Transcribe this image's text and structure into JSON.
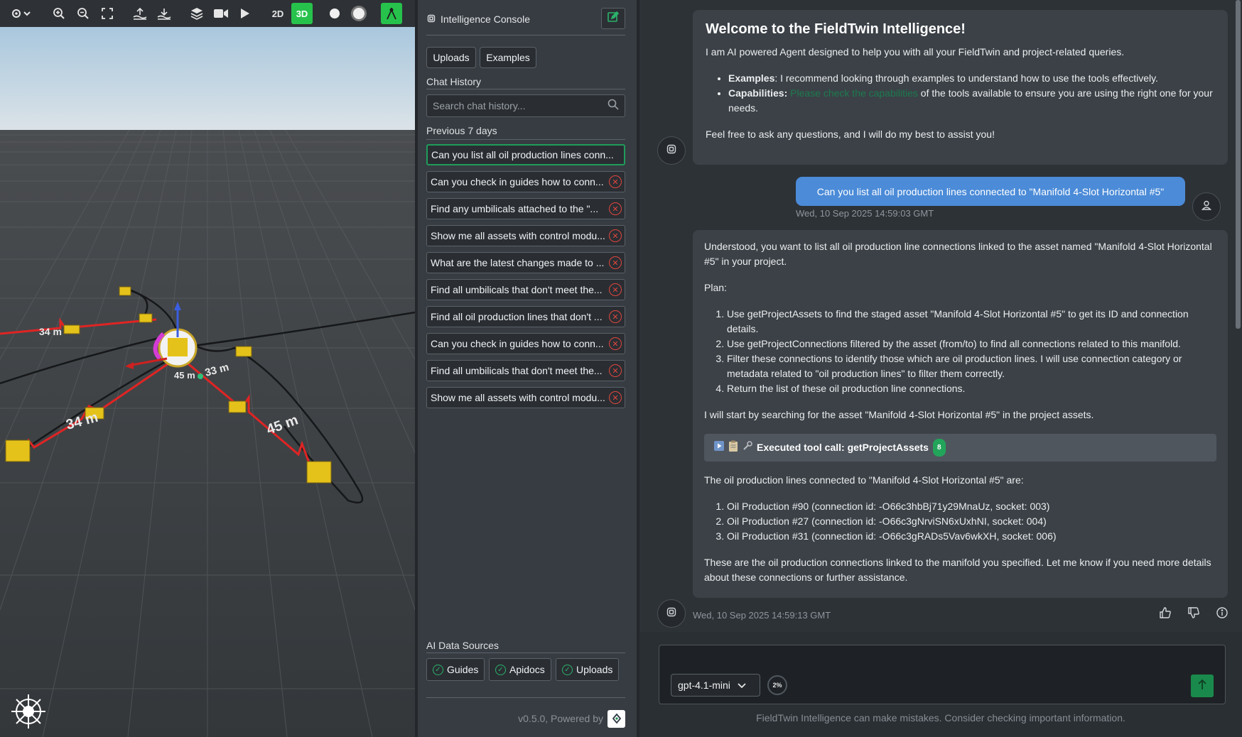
{
  "toolbar": {
    "mode_2d": "2D",
    "mode_3d": "3D"
  },
  "viewport": {
    "labels": [
      "34 m",
      "34 m",
      "33 m",
      "45 m",
      "45 m"
    ]
  },
  "sidebar": {
    "title": "Intelligence Console",
    "tabs": [
      "Uploads",
      "Examples"
    ],
    "chat_history_label": "Chat History",
    "search_placeholder": "Search chat history...",
    "group_label": "Previous 7 days",
    "history": [
      "Can you list all oil production lines conn...",
      "Can you check in guides how to conn...",
      "Find any umbilicals attached to the \"...",
      "Show me all assets with control modu...",
      "What are the latest changes made to ...",
      "Find all umbilicals that don't meet the...",
      "Find all oil production lines that don't ...",
      "Can you check in guides how to conn...",
      "Find all umbilicals that don't meet the...",
      "Show me all assets with control modu..."
    ],
    "data_sources_label": "AI Data Sources",
    "data_sources": [
      "Guides",
      "Apidocs",
      "Uploads"
    ],
    "version": "v0.5.0, Powered by"
  },
  "chat": {
    "welcome": {
      "title": "Welcome to the FieldTwin Intelligence!",
      "intro": "I am AI powered Agent designed to help you with all your FieldTwin and project-related queries.",
      "bullet1_label": "Examples",
      "bullet1_text": ": I recommend looking through examples to understand how to use the tools effectively.",
      "bullet2_label": "Capabilities:",
      "bullet2_link": "Please check the capabilities",
      "bullet2_text": " of the tools available to ensure you are using the right one for your needs.",
      "outro": "Feel free to ask any questions, and I will do my best to assist you!"
    },
    "user_message": "Can you list all oil production lines connected to \"Manifold 4-Slot Horizontal #5\"",
    "user_timestamp": "Wed, 10 Sep 2025 14:59:03 GMT",
    "reply": {
      "p1": "Understood, you want to list all oil production line connections linked to the asset named \"Manifold 4-Slot Horizontal #5\" in your project.",
      "plan_label": "Plan:",
      "plan": [
        "Use getProjectAssets to find the staged asset \"Manifold 4-Slot Horizontal #5\" to get its ID and connection details.",
        "Use getProjectConnections filtered by the asset (from/to) to find all connections related to this manifold.",
        "Filter these connections to identify those which are oil production lines. I will use connection category or metadata related to \"oil production lines\" to filter them correctly.",
        "Return the list of these oil production line connections."
      ],
      "p2": "I will start by searching for the asset \"Manifold 4-Slot Horizontal #5\" in the project assets.",
      "tool_call_label": "Executed tool call: getProjectAssets",
      "tool_call_badge": "8",
      "p3": "The oil production lines connected to \"Manifold 4-Slot Horizontal #5\" are:",
      "results": [
        "Oil Production #90 (connection id: -O66c3hbBj71y29MnaUz, socket: 003)",
        "Oil Production #27 (connection id: -O66c3gNrviSN6xUxhNI, socket: 004)",
        "Oil Production #31 (connection id: -O66c3gRADs5Vav6wkXH, socket: 006)"
      ],
      "p4": "These are the oil production connections linked to the manifold you specified. Let me know if you need more details about these connections or further assistance."
    },
    "reply_timestamp": "Wed, 10 Sep 2025 14:59:13 GMT",
    "model": "gpt-4.1-mini",
    "context_usage": "2%",
    "disclaimer": "FieldTwin Intelligence can make mistakes. Consider checking important information."
  },
  "colors": {
    "accent_green": "#27c24c",
    "user_bubble": "#4b8bd8",
    "error_red": "#e0463e"
  }
}
